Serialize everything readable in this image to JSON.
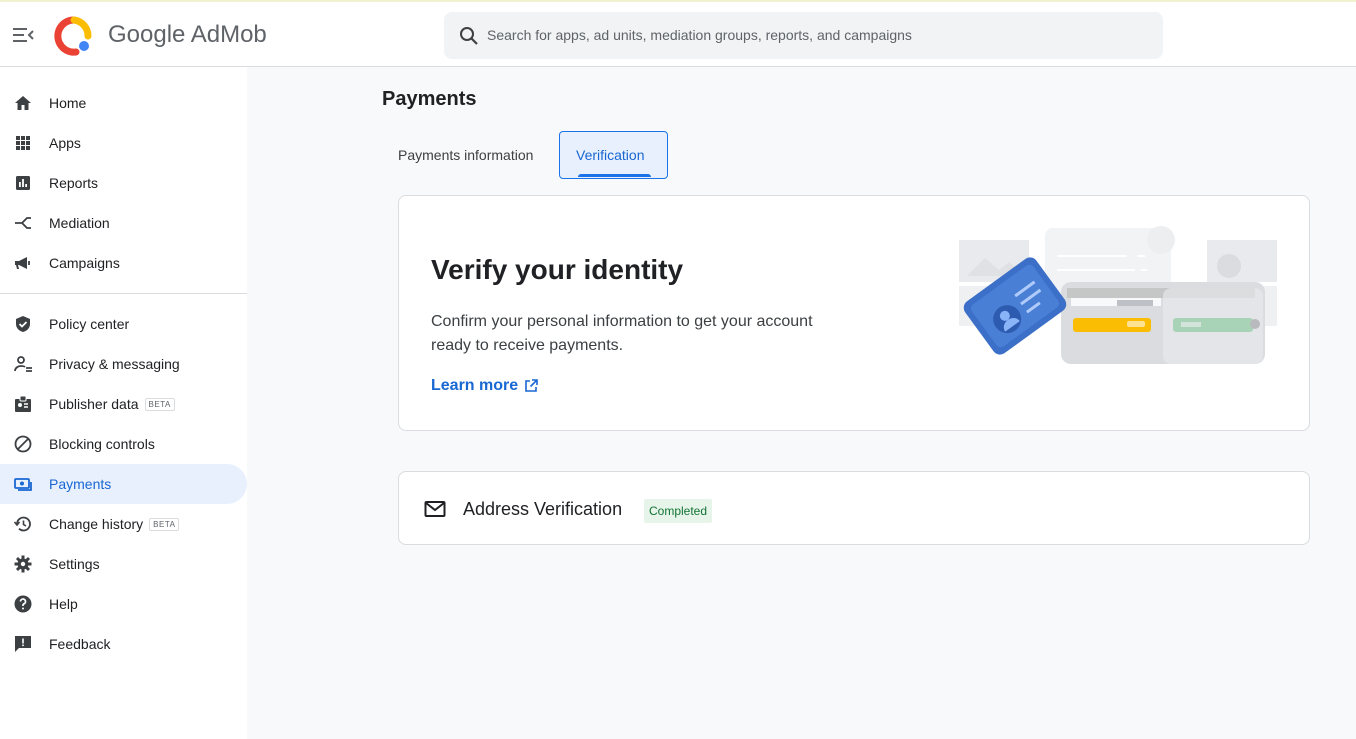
{
  "app": {
    "brand": "Google AdMob"
  },
  "search": {
    "placeholder": "Search for apps, ad units, mediation groups, reports, and campaigns"
  },
  "sidebar": {
    "items": [
      {
        "label": "Home",
        "icon": "home-icon"
      },
      {
        "label": "Apps",
        "icon": "apps-grid-icon"
      },
      {
        "label": "Reports",
        "icon": "bar-chart-icon"
      },
      {
        "label": "Mediation",
        "icon": "mediation-icon"
      },
      {
        "label": "Campaigns",
        "icon": "megaphone-icon"
      },
      {
        "label": "Policy center",
        "icon": "shield-check-icon"
      },
      {
        "label": "Privacy & messaging",
        "icon": "person-settings-icon"
      },
      {
        "label": "Publisher data",
        "icon": "badge-icon",
        "badge": "BETA"
      },
      {
        "label": "Blocking controls",
        "icon": "block-icon"
      },
      {
        "label": "Payments",
        "icon": "payments-icon",
        "active": true
      },
      {
        "label": "Change history",
        "icon": "history-icon",
        "badge": "BETA"
      },
      {
        "label": "Settings",
        "icon": "gear-icon"
      },
      {
        "label": "Help",
        "icon": "help-icon"
      },
      {
        "label": "Feedback",
        "icon": "feedback-icon"
      }
    ]
  },
  "main": {
    "title": "Payments",
    "tabs": [
      {
        "label": "Payments information",
        "active": false
      },
      {
        "label": "Verification",
        "active": true
      }
    ],
    "identity_card": {
      "title": "Verify your identity",
      "description": "Confirm your personal information to get your account ready to receive payments.",
      "link": "Learn more"
    },
    "address_card": {
      "title": "Address Verification",
      "status": "Completed"
    }
  },
  "colors": {
    "accent": "#1a73e8",
    "active_bg": "#e8f0fe",
    "success_text": "#137333",
    "success_bg": "#e6f4ea"
  }
}
